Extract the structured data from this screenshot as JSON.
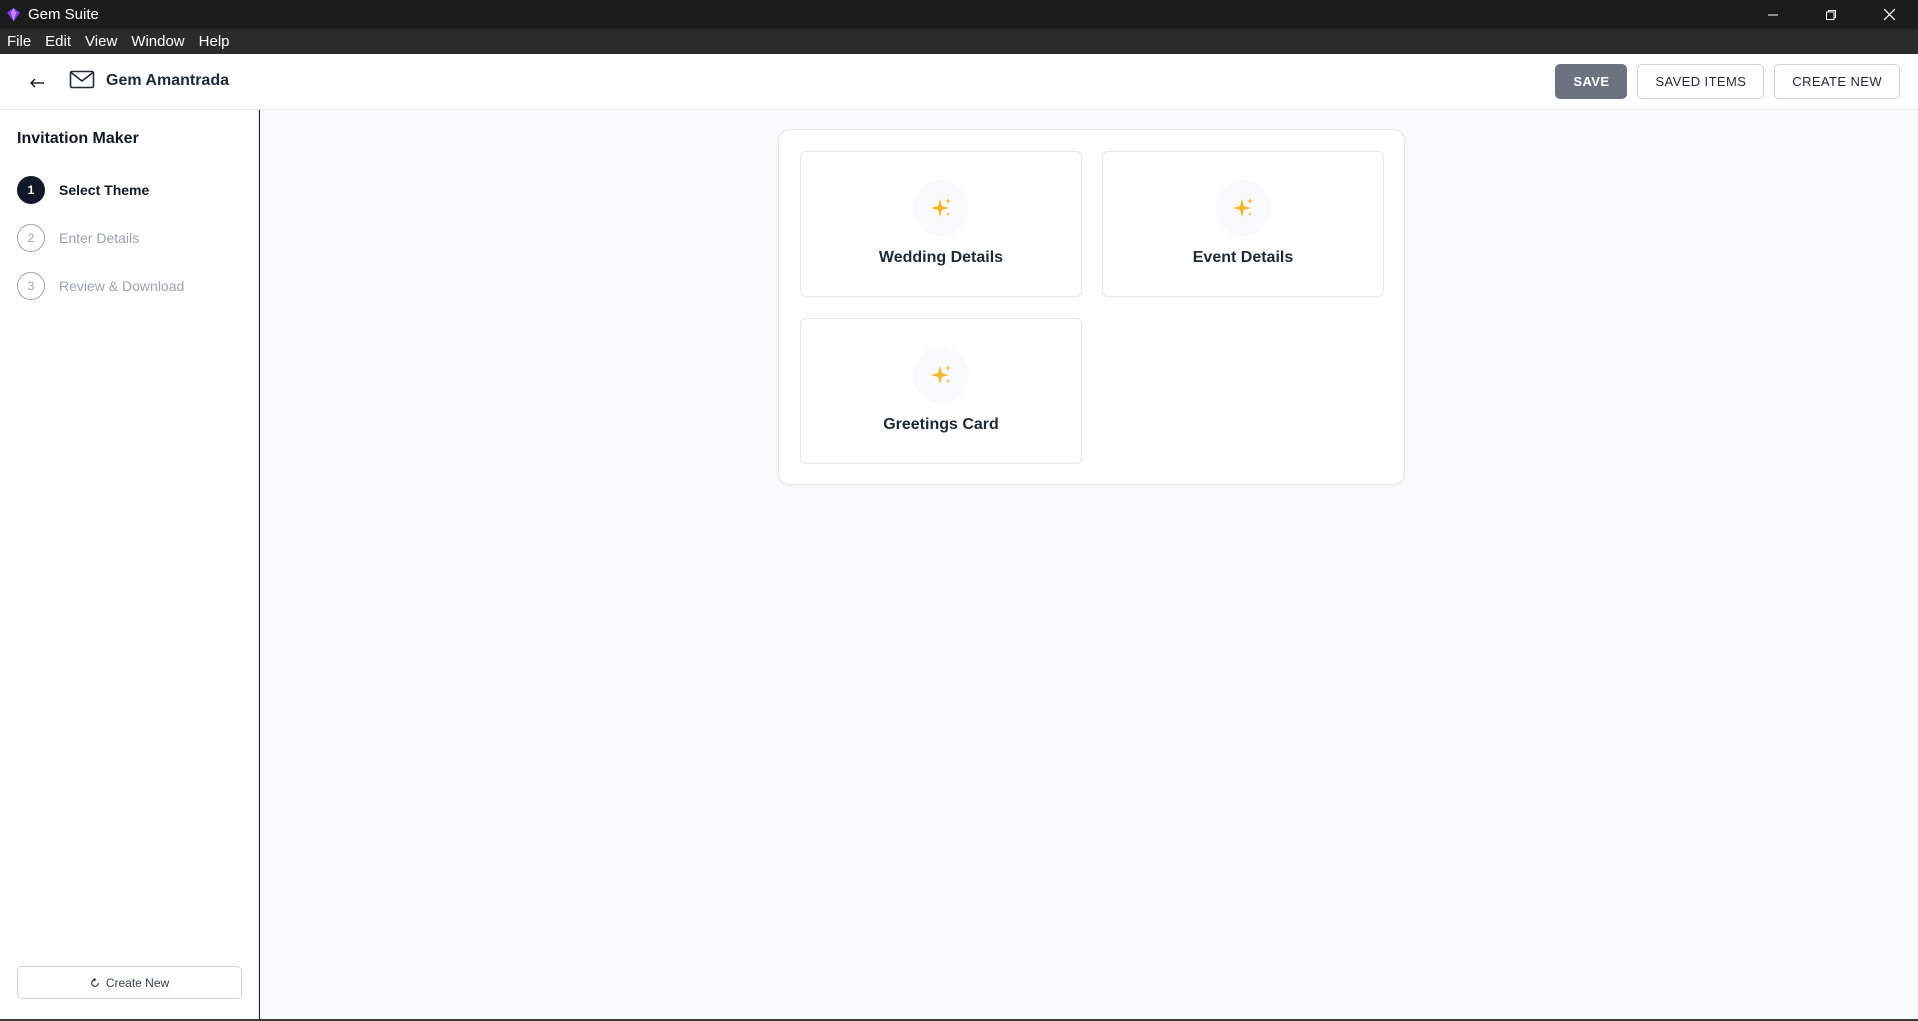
{
  "window": {
    "title": "Gem Suite"
  },
  "menu": [
    "File",
    "Edit",
    "View",
    "Window",
    "Help"
  ],
  "header": {
    "app_name": "Gem Amantrada",
    "save_label": "SAVE",
    "saved_items_label": "SAVED ITEMS",
    "create_new_label": "CREATE NEW"
  },
  "sidebar": {
    "title": "Invitation Maker",
    "steps": [
      {
        "num": "1",
        "label": "Select Theme",
        "active": true
      },
      {
        "num": "2",
        "label": "Enter Details",
        "active": false
      },
      {
        "num": "3",
        "label": "Review & Download",
        "active": false
      }
    ],
    "create_new_label": "Create New"
  },
  "themes": [
    {
      "label": "Wedding Details",
      "icon": "sparkles-icon"
    },
    {
      "label": "Event Details",
      "icon": "sparkles-icon"
    },
    {
      "label": "Greetings Card",
      "icon": "sparkles-icon"
    }
  ],
  "colors": {
    "active_step": "#111827",
    "save_button": "#6b7280",
    "sparkle": "#f5b82e"
  }
}
